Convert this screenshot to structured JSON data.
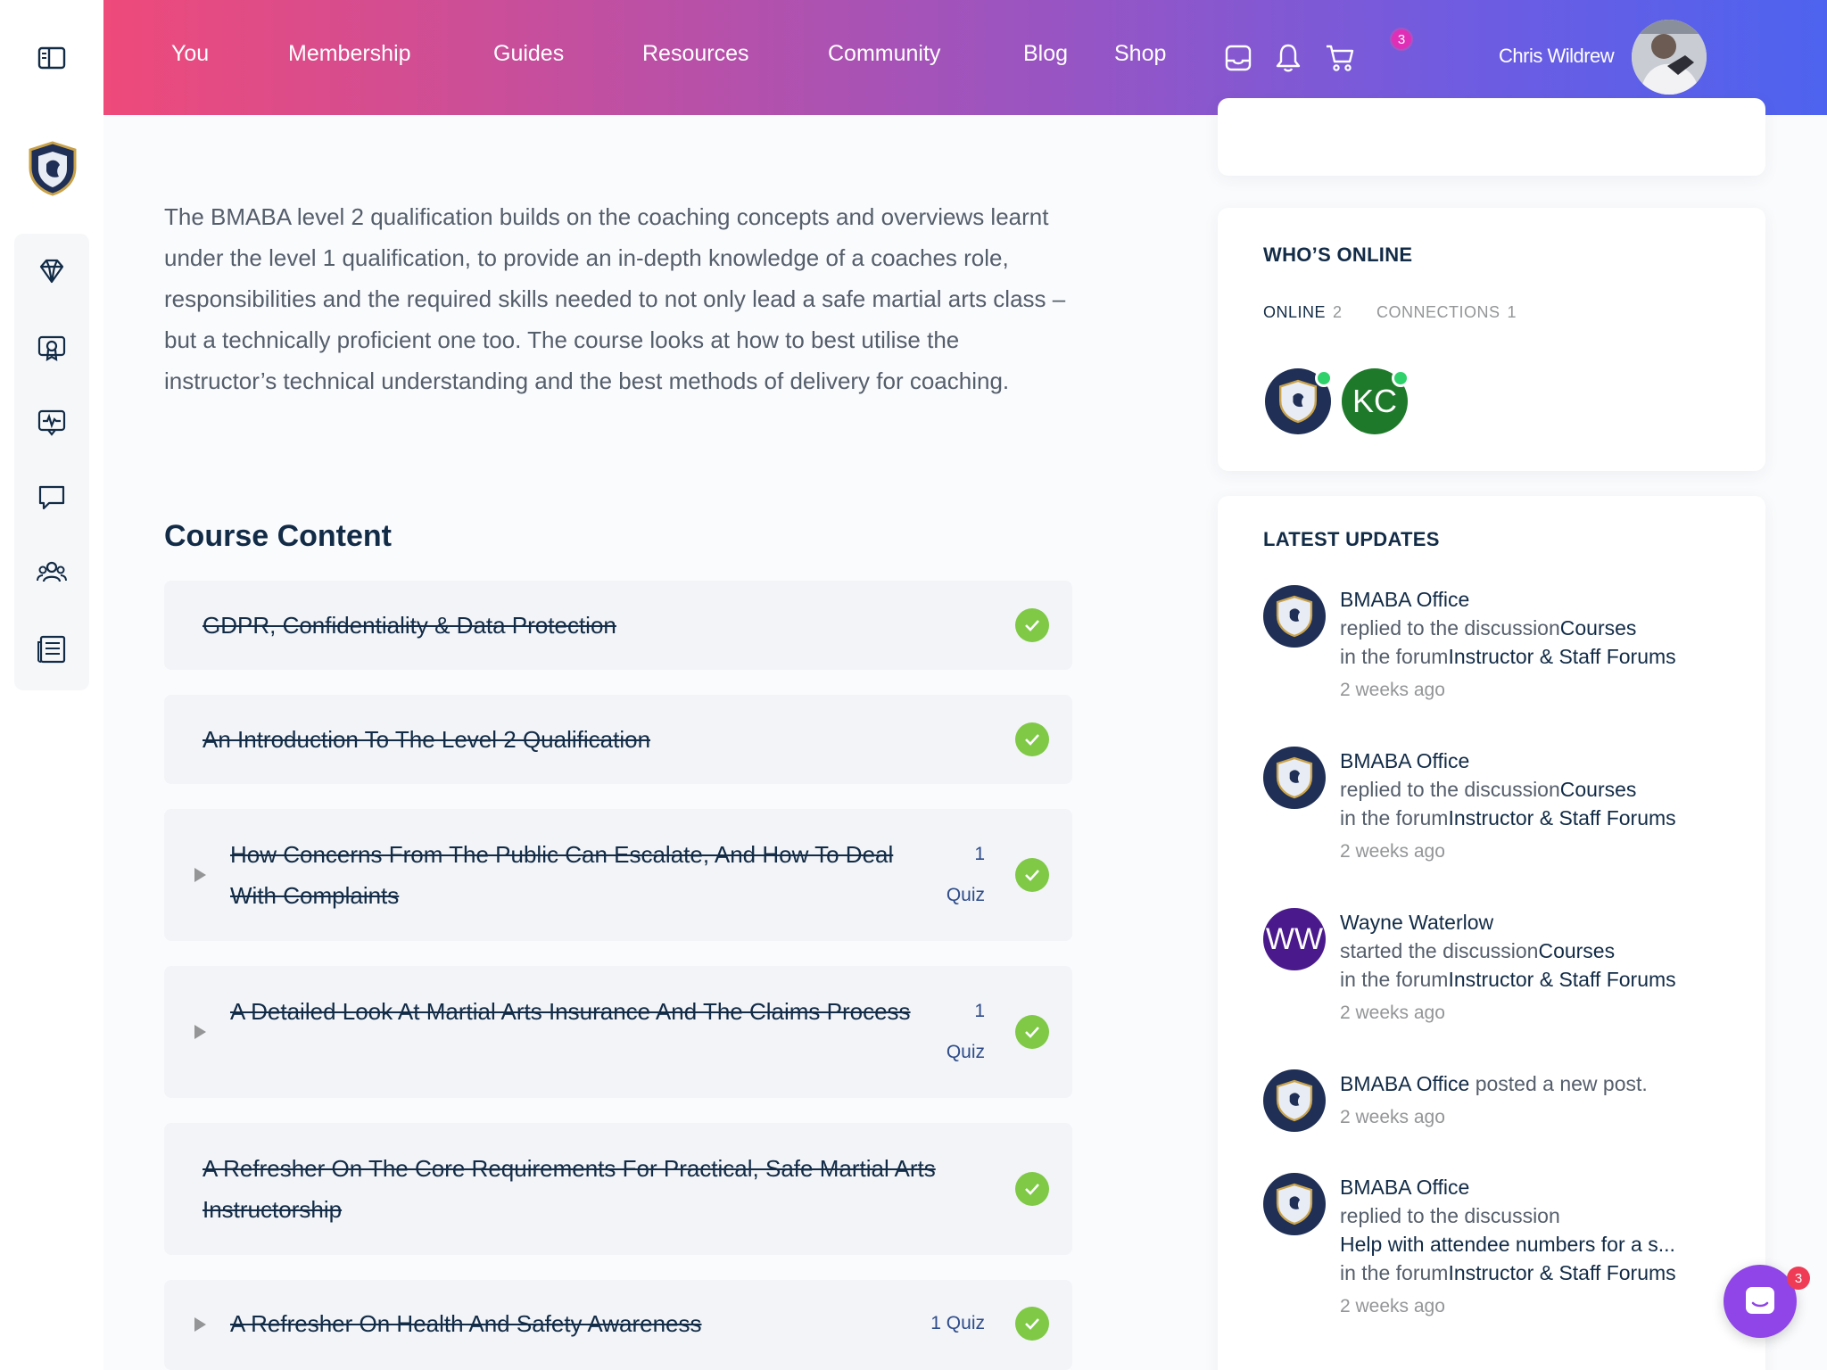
{
  "nav": {
    "items": [
      "You",
      "Membership",
      "Guides",
      "Resources",
      "Community",
      "Blog",
      "Shop"
    ],
    "notification_count": "3",
    "user_name": "Chris Wildrew"
  },
  "course": {
    "description": "The BMABA level 2 qualification builds on the coaching concepts and overviews learnt under the level 1 qualification, to provide an in-depth knowledge of a coaches role, responsibilities and the required skills needed to not only lead a safe martial arts class – but a technically proficient one too. The course looks at how to best utilise the instructor’s technical understanding and the best methods of delivery for coaching.",
    "section_title": "Course Content",
    "lessons": [
      {
        "title": "GDPR, Confidentiality & Data Protection",
        "completed": true
      },
      {
        "title": "An Introduction To The Level 2 Qualification",
        "completed": true
      },
      {
        "title": "How Concerns From The Public Can Escalate, And How To Deal With Complaints",
        "count": "1",
        "quiz_label": "Quiz",
        "completed": true
      },
      {
        "title": "A Detailed Look At Martial Arts Insurance And The Claims Process",
        "count": "1",
        "quiz_label": "Quiz",
        "completed": true
      },
      {
        "title": "A Refresher On The Core Requirements For Practical, Safe Martial Arts Instructorship",
        "completed": true
      },
      {
        "title": "A Refresher On Health And Safety Awareness",
        "quiz_label": "1 Quiz",
        "completed": true
      }
    ]
  },
  "whos_online": {
    "title": "WHO’S ONLINE",
    "tabs": [
      {
        "label": "ONLINE",
        "count": "2"
      },
      {
        "label": "CONNECTIONS",
        "count": "1"
      }
    ],
    "avatars": [
      {
        "initials": "",
        "color": "#1f2f55"
      },
      {
        "initials": "KC",
        "color": "#1e7a2a"
      }
    ]
  },
  "latest_updates": {
    "title": "LATEST UPDATES",
    "items": [
      {
        "who": "BMABA Office",
        "action": "replied to the discussion",
        "target": "Courses",
        "forum_prefix": "in the forum",
        "forum": "Instructor & Staff Forums",
        "time": "2 weeks ago"
      },
      {
        "who": "BMABA Office",
        "action": "replied to the discussion",
        "target": "Courses",
        "forum_prefix": "in the forum",
        "forum": "Instructor & Staff Forums",
        "time": "2 weeks ago"
      },
      {
        "who": "Wayne Waterlow",
        "initials": "WW",
        "action": "started the discussion",
        "target": "Courses",
        "forum_prefix": "in the forum",
        "forum": "Instructor & Staff Forums",
        "time": "2 weeks ago"
      },
      {
        "who": "BMABA Office",
        "action": " posted a new post.",
        "time": "2 weeks ago"
      },
      {
        "who": "BMABA Office",
        "action": "replied to the discussion",
        "target": "Help with attendee numbers for a s...",
        "forum_prefix": "in the forum",
        "forum": "Instructor & Staff Forums",
        "time": "2 weeks ago"
      }
    ]
  },
  "chat": {
    "badge": "3"
  },
  "colors": {
    "header_gradient": [
      "#ee4a7a",
      "#9455c6",
      "#4d63ef"
    ],
    "check_green": "#7fc946",
    "online_green": "#2fd16a",
    "chat_purple": "#8f45e8",
    "text_dark": "#122b46",
    "text_muted": "#939597"
  },
  "icons": {
    "rail": [
      "sidebar-toggle-icon",
      "club-crest-logo",
      "gem-icon",
      "course-certificate-icon",
      "activity-monitor-icon",
      "forum-chat-icon",
      "members-group-icon",
      "news-page-icon"
    ],
    "header": [
      "inbox-icon",
      "bell-icon",
      "cart-icon"
    ]
  }
}
